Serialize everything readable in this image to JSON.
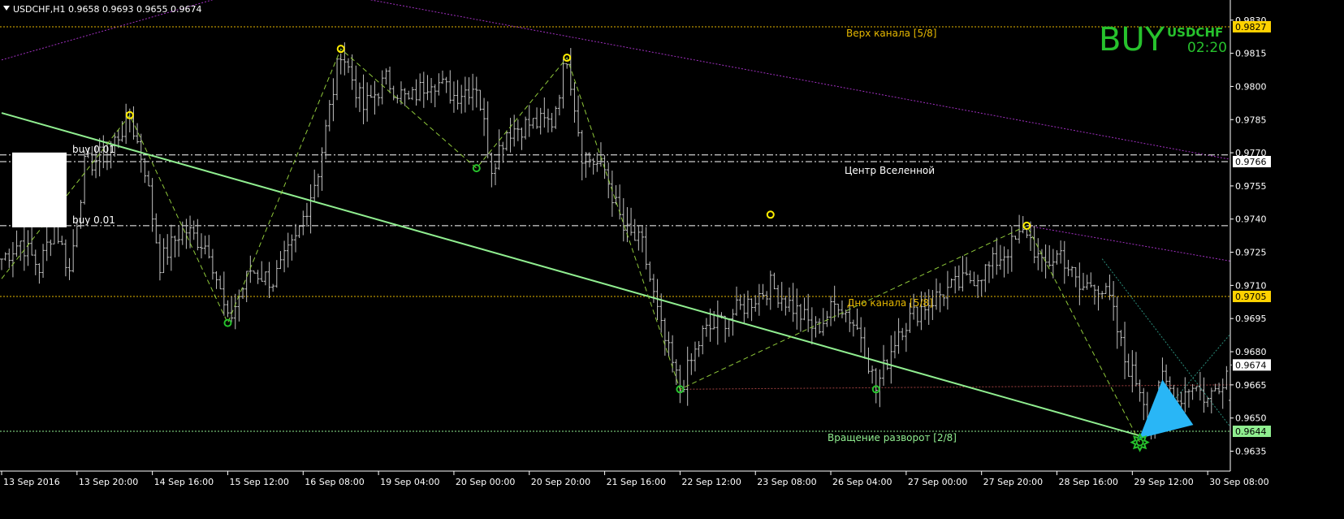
{
  "header": {
    "symbol_info": "USDCHF,H1  0.9658 0.9693 0.9655 0.9674",
    "menu_icon": "triangle-down-icon"
  },
  "signal": {
    "action": "BUY",
    "symbol": "USDCHF",
    "time": "02:20",
    "color": "#27c22d"
  },
  "colors": {
    "background": "#000000",
    "axis": "#ffffff",
    "price_bars": "#c0c0c0",
    "channel_level": "#e6b800",
    "center_level": "#ffffff",
    "zigzag": "#8fc93a",
    "trendline": "#90ee90",
    "purple_line": "#a030c0",
    "teal_line": "#2a8c7a",
    "pattern_fill": "#29b6f6",
    "current_price_box": "#ffffff",
    "channel_price_box": "#ffd200",
    "rotation_price_box": "#90ee90"
  },
  "chart_data": {
    "type": "line",
    "subtype": "ohlc-bars",
    "ylim": [
      0.9626,
      0.9838
    ],
    "y_ticks": [
      "0.9830",
      "0.9815",
      "0.9800",
      "0.9785",
      "0.9770",
      "0.9755",
      "0.9740",
      "0.9725",
      "0.9710",
      "0.9695",
      "0.9680",
      "0.9665",
      "0.9650",
      "0.9635"
    ],
    "x_ticks": [
      "13 Sep 2016",
      "13 Sep 20:00",
      "14 Sep 16:00",
      "15 Sep 12:00",
      "16 Sep 08:00",
      "19 Sep 04:00",
      "20 Sep 00:00",
      "20 Sep 20:00",
      "21 Sep 16:00",
      "22 Sep 12:00",
      "23 Sep 08:00",
      "26 Sep 04:00",
      "27 Sep 00:00",
      "27 Sep 20:00",
      "28 Sep 16:00",
      "29 Sep 12:00",
      "30 Sep 08:00"
    ],
    "x_tick_bar_index": [
      0,
      20,
      40,
      60,
      80,
      100,
      120,
      140,
      160,
      180,
      200,
      220,
      240,
      260,
      280,
      300,
      320
    ],
    "bar_count": 327,
    "price_path": [
      [
        0,
        0.9722
      ],
      [
        5,
        0.973
      ],
      [
        10,
        0.9718
      ],
      [
        14,
        0.9738
      ],
      [
        18,
        0.9716
      ],
      [
        22,
        0.9764
      ],
      [
        28,
        0.977
      ],
      [
        34,
        0.9786
      ],
      [
        38,
        0.9763
      ],
      [
        42,
        0.972
      ],
      [
        48,
        0.9736
      ],
      [
        55,
        0.9727
      ],
      [
        60,
        0.9693
      ],
      [
        66,
        0.9717
      ],
      [
        72,
        0.9712
      ],
      [
        78,
        0.973
      ],
      [
        84,
        0.9762
      ],
      [
        90,
        0.9817
      ],
      [
        96,
        0.979
      ],
      [
        102,
        0.9803
      ],
      [
        108,
        0.9793
      ],
      [
        114,
        0.9804
      ],
      [
        120,
        0.9796
      ],
      [
        126,
        0.9801
      ],
      [
        130,
        0.9764
      ],
      [
        134,
        0.978
      ],
      [
        140,
        0.9783
      ],
      [
        146,
        0.9784
      ],
      [
        150,
        0.9814
      ],
      [
        154,
        0.977
      ],
      [
        160,
        0.9762
      ],
      [
        165,
        0.9735
      ],
      [
        170,
        0.9728
      ],
      [
        175,
        0.969
      ],
      [
        180,
        0.9663
      ],
      [
        186,
        0.9688
      ],
      [
        192,
        0.9695
      ],
      [
        198,
        0.9702
      ],
      [
        204,
        0.971
      ],
      [
        210,
        0.97
      ],
      [
        216,
        0.969
      ],
      [
        222,
        0.9703
      ],
      [
        228,
        0.9688
      ],
      [
        232,
        0.9663
      ],
      [
        238,
        0.969
      ],
      [
        244,
        0.97
      ],
      [
        250,
        0.9707
      ],
      [
        256,
        0.9712
      ],
      [
        262,
        0.9718
      ],
      [
        268,
        0.9728
      ],
      [
        272,
        0.9735
      ],
      [
        276,
        0.9718
      ],
      [
        281,
        0.9725
      ],
      [
        286,
        0.9708
      ],
      [
        290,
        0.9712
      ],
      [
        294,
        0.9703
      ],
      [
        298,
        0.9676
      ],
      [
        302,
        0.9664
      ],
      [
        305,
        0.9648
      ],
      [
        308,
        0.9668
      ],
      [
        312,
        0.9658
      ],
      [
        316,
        0.9666
      ],
      [
        320,
        0.9658
      ],
      [
        326,
        0.9674
      ]
    ],
    "last_bar": {
      "open": 0.9658,
      "high": 0.9693,
      "low": 0.9655,
      "close": 0.9674
    },
    "levels": [
      {
        "name": "Верх канала [5/8]",
        "price": 0.9827,
        "box": "0.9827",
        "style": "dotted",
        "color": "#e6b800"
      },
      {
        "name": "Центр Вселенной",
        "price": 0.9766,
        "box": "0.9766",
        "style": "dashdot",
        "color": "#ffffff"
      },
      {
        "name": "Дно канала [5/8]",
        "price": 0.9705,
        "box": "0.9705",
        "style": "dotted",
        "color": "#e6b800"
      },
      {
        "name": "Вращение разворот [2/8]",
        "price": 0.9644,
        "box": "0.9644",
        "style": "dotted",
        "color": "#90ee90"
      }
    ],
    "orders": [
      {
        "label": "buy 0.01",
        "price": 0.9769
      },
      {
        "label": "buy 0.01",
        "price": 0.9737
      }
    ],
    "extra_lines": [
      {
        "price": 0.9737,
        "style": "dashdot",
        "color": "#ffffff"
      }
    ],
    "current_price": "0.9674",
    "zigzag": [
      [
        0,
        0.9713
      ],
      [
        34,
        0.9787
      ],
      [
        60,
        0.9693
      ],
      [
        90,
        0.9817
      ],
      [
        126,
        0.9763
      ],
      [
        150,
        0.9813
      ],
      [
        180,
        0.9663
      ],
      [
        272,
        0.9737
      ],
      [
        302,
        0.9639
      ]
    ],
    "zigzag_highs": [
      [
        34,
        0.9787
      ],
      [
        90,
        0.9817
      ],
      [
        150,
        0.9813
      ],
      [
        204,
        0.9742
      ],
      [
        272,
        0.9737
      ]
    ],
    "zigzag_lows": [
      [
        60,
        0.9693
      ],
      [
        126,
        0.9763
      ],
      [
        180,
        0.9663
      ],
      [
        232,
        0.9663
      ]
    ],
    "reversal_marker": [
      302,
      0.9639
    ],
    "trendline": [
      [
        0,
        0.9788
      ],
      [
        302,
        0.9642
      ]
    ],
    "purple_lines": [
      [
        [
          0,
          0.9812
        ],
        [
          70,
          0.9846
        ]
      ],
      [
        [
          70,
          0.9848
        ],
        [
          326,
          0.9767
        ]
      ],
      [
        [
          272,
          0.9737
        ],
        [
          326,
          0.9721
        ]
      ]
    ],
    "red_support": [
      [
        180,
        0.9663
      ],
      [
        326,
        0.9665
      ]
    ],
    "teal_lines": [
      [
        [
          292,
          0.9722
        ],
        [
          326,
          0.9646
        ]
      ],
      [
        [
          302,
          0.964
        ],
        [
          326,
          0.9688
        ]
      ]
    ],
    "pattern_triangle": [
      [
        302,
        0.9641
      ],
      [
        308,
        0.9667
      ],
      [
        316,
        0.9647
      ]
    ]
  }
}
